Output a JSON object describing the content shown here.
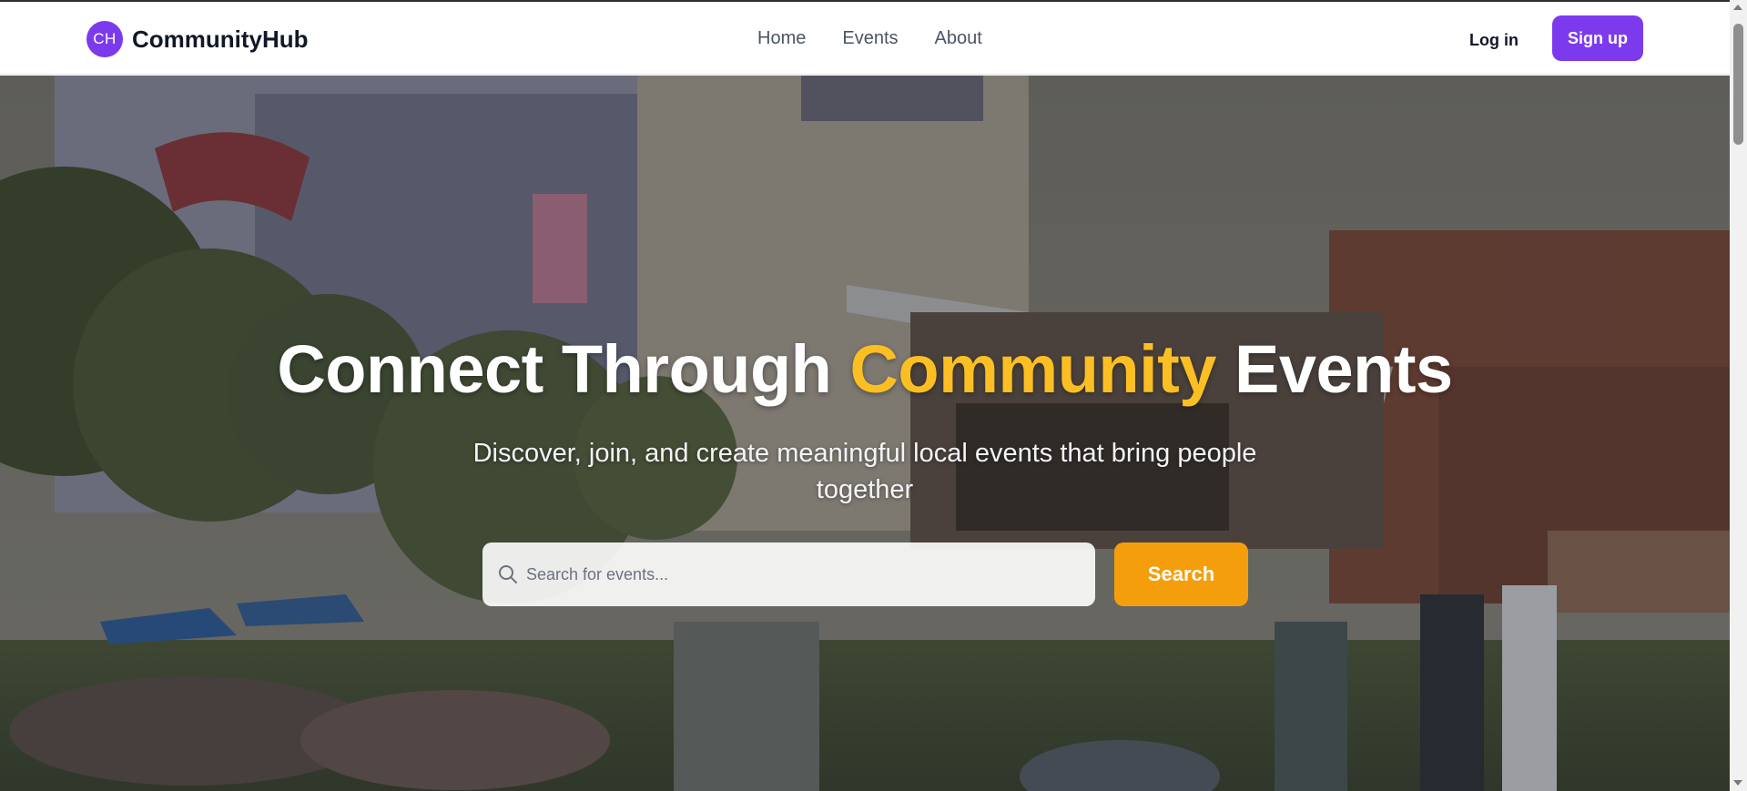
{
  "brand": {
    "logo_initials": "CH",
    "name": "CommunityHub",
    "accent_color": "#7c3aed"
  },
  "nav": {
    "items": [
      {
        "label": "Home"
      },
      {
        "label": "Events"
      },
      {
        "label": "About"
      }
    ]
  },
  "auth": {
    "login_label": "Log in",
    "signup_label": "Sign up"
  },
  "hero": {
    "title_part1": "Connect Through ",
    "title_accent": "Community",
    "title_part2": " Events",
    "title_accent_color": "#fbbf24",
    "subtitle": "Discover, join, and create meaningful local events that bring people together"
  },
  "search": {
    "placeholder": "Search for events...",
    "value": "",
    "button_label": "Search",
    "button_color": "#f59e0b",
    "icon": "search-icon"
  }
}
